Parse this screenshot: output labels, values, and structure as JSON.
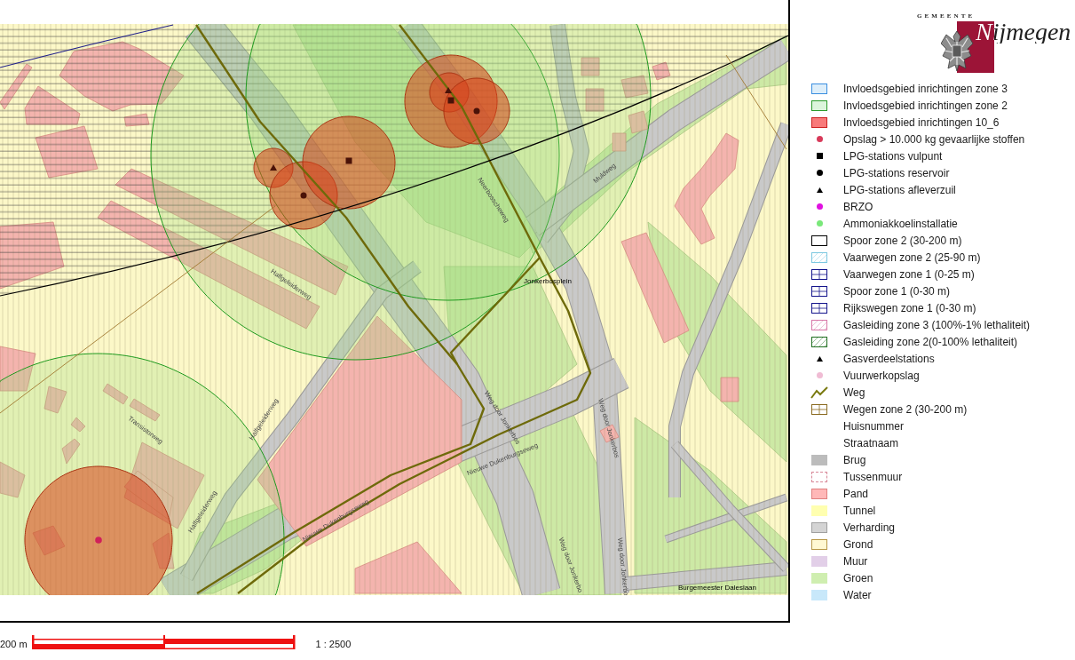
{
  "map": {
    "labels": [
      {
        "text": "Muldweg",
        "kind": "street"
      },
      {
        "text": "Neerbosscheweg",
        "kind": "street"
      },
      {
        "text": "Jonkerbosplein",
        "kind": "place"
      },
      {
        "text": "Halfgeleiderweg",
        "kind": "street"
      },
      {
        "text": "Weg door Jonkerbos",
        "kind": "street"
      },
      {
        "text": "Halfgeleiderweg",
        "kind": "street"
      },
      {
        "text": "Weg door Jonkerbos",
        "kind": "street"
      },
      {
        "text": "Transistorweg",
        "kind": "street"
      },
      {
        "text": "Nieuwe Dukenburgseweg",
        "kind": "street"
      },
      {
        "text": "Halfgeleiderweg",
        "kind": "street"
      },
      {
        "text": "Nieuwe Dukenburgseweg",
        "kind": "street"
      },
      {
        "text": "Weg door Jonkerbo",
        "kind": "street"
      },
      {
        "text": "Weg door Jonkerbo",
        "kind": "street"
      },
      {
        "text": "Burgemeester Daleslaan",
        "kind": "place"
      }
    ]
  },
  "legend": {
    "logo": {
      "caption": "GEMEENTE",
      "name": "Nijmegen"
    },
    "items": [
      {
        "label": "Invloedsgebied inrichtingen zone 3",
        "kind": "fill",
        "color": "#ddeefa",
        "outline": {
          "color": "#3a8ee0"
        }
      },
      {
        "label": "Invloedsgebied inrichtingen zone 2",
        "kind": "fill",
        "color": "#dcf5dc",
        "outline": {
          "color": "#2a9a2a"
        }
      },
      {
        "label": "Invloedsgebied inrichtingen 10_6",
        "kind": "fill",
        "color": "#f87a7a",
        "outline": {
          "color": "#cc2020"
        }
      },
      {
        "label": "Opslag > 10.000 kg gevaarlijke stoffen",
        "kind": "dot",
        "color": "#d83a5a"
      },
      {
        "label": "LPG-stations vulpunt",
        "kind": "square",
        "color": "#000000"
      },
      {
        "label": "LPG-stations reservoir",
        "kind": "dot",
        "color": "#000000"
      },
      {
        "label": "LPG-stations afleverzuil",
        "kind": "triangle",
        "color": "#000000"
      },
      {
        "label": "BRZO",
        "kind": "dot",
        "color": "#e010e0"
      },
      {
        "label": "Ammoniakkoelinstallatie",
        "kind": "dot",
        "color": "#7ae87a"
      },
      {
        "label": "Spoor zone 2 (30-200 m)",
        "kind": "outline",
        "color": "#000000"
      },
      {
        "label": "Vaarwegen zone 2 (25-90 m)",
        "kind": "hatch",
        "color": "#7cc8e0"
      },
      {
        "label": "Vaarwegen zone 1 (0-25 m)",
        "kind": "grid",
        "color": "#14148c"
      },
      {
        "label": "Spoor zone 1 (0-30 m)",
        "kind": "grid",
        "color": "#14148c"
      },
      {
        "label": "Rijkswegen zone 1 (0-30 m)",
        "kind": "grid",
        "color": "#14148c"
      },
      {
        "label": "Gasleiding zone 3 (100%-1% lethaliteit)",
        "kind": "hatch",
        "color": "#d878a8"
      },
      {
        "label": "Gasleiding zone 2(0-100% lethaliteit)",
        "kind": "hatch",
        "color": "#1e6e1e"
      },
      {
        "label": "Gasverdeelstations",
        "kind": "triangle",
        "color": "#000000"
      },
      {
        "label": "Vuurwerkopslag",
        "kind": "dot",
        "color": "#f0bcd4"
      },
      {
        "label": "Weg",
        "kind": "line",
        "color": "#7a7a10"
      },
      {
        "label": "Wegen zone 2 (30-200 m)",
        "kind": "grid",
        "color": "#8a6a20"
      },
      {
        "label": "Huisnummer",
        "kind": "none"
      },
      {
        "label": "Straatnaam",
        "kind": "none"
      },
      {
        "label": "Brug",
        "kind": "fill",
        "color": "#bcbcbc"
      },
      {
        "label": "Tussenmuur",
        "kind": "dashed",
        "color": "#d88898"
      },
      {
        "label": "Pand",
        "kind": "fill",
        "color": "#ffb8b8",
        "outline": {
          "color": "#e08080"
        }
      },
      {
        "label": "Tunnel",
        "kind": "fill",
        "color": "#ffffb0"
      },
      {
        "label": "Verharding",
        "kind": "fill",
        "color": "#d4d4d4",
        "outline": {
          "color": "#a0a0a0"
        }
      },
      {
        "label": "Grond",
        "kind": "fill",
        "color": "#fff8d2",
        "outline": {
          "color": "#b89848"
        }
      },
      {
        "label": "Muur",
        "kind": "fill",
        "color": "#e2cfe8"
      },
      {
        "label": "Groen",
        "kind": "fill",
        "color": "#cfeeb0"
      },
      {
        "label": "Water",
        "kind": "fill",
        "color": "#c8e8fa"
      }
    ]
  },
  "scale_bar": {
    "distance": "200 m",
    "ratio": "1 : 2500"
  }
}
